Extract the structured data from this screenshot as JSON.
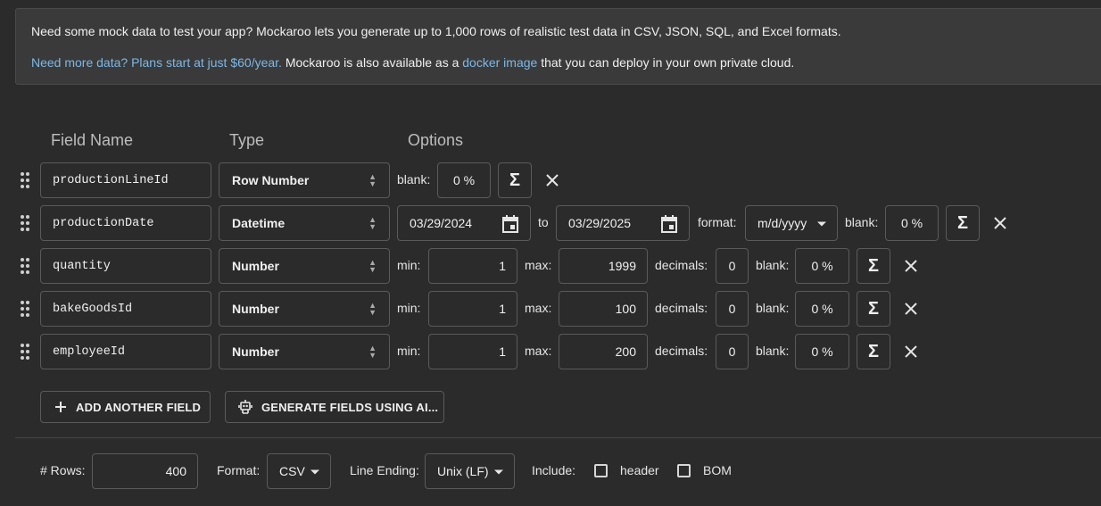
{
  "banner": {
    "line1": "Need some mock data to test your app? Mockaroo lets you generate up to 1,000 rows of realistic test data in CSV, JSON, SQL, and Excel formats.",
    "more_data_link": "Need more data? Plans start at just $60/year.",
    "mid_text": " Mockaroo is also available as a ",
    "docker_link": "docker image",
    "end_text": " that you can deploy in your own private cloud."
  },
  "headers": {
    "field_name": "Field Name",
    "type": "Type",
    "options": "Options"
  },
  "labels": {
    "blank": "blank:",
    "to": "to",
    "format": "format:",
    "min": "min:",
    "max": "max:",
    "decimals": "decimals:",
    "sigma": "Σ",
    "remove": "✕"
  },
  "fields": [
    {
      "name": "productionLineId",
      "type": "Row Number",
      "blank": "0 %"
    },
    {
      "name": "productionDate",
      "type": "Datetime",
      "from": "03/29/2024",
      "to": "03/29/2025",
      "format": "m/d/yyyy",
      "blank": "0 %"
    },
    {
      "name": "quantity",
      "type": "Number",
      "min": "1",
      "max": "1999",
      "decimals": "0",
      "blank": "0 %"
    },
    {
      "name": "bakeGoodsId",
      "type": "Number",
      "min": "1",
      "max": "100",
      "decimals": "0",
      "blank": "0 %"
    },
    {
      "name": "employeeId",
      "type": "Number",
      "min": "1",
      "max": "200",
      "decimals": "0",
      "blank": "0 %"
    }
  ],
  "actions": {
    "add_field": "ADD ANOTHER FIELD",
    "generate_ai": "GENERATE FIELDS USING AI..."
  },
  "footer": {
    "rows_label": "# Rows:",
    "rows_value": "400",
    "format_label": "Format:",
    "format_value": "CSV",
    "line_ending_label": "Line Ending:",
    "line_ending_value": "Unix (LF)",
    "include_label": "Include:",
    "header_label": "header",
    "bom_label": "BOM",
    "header_checked": false,
    "bom_checked": false
  }
}
